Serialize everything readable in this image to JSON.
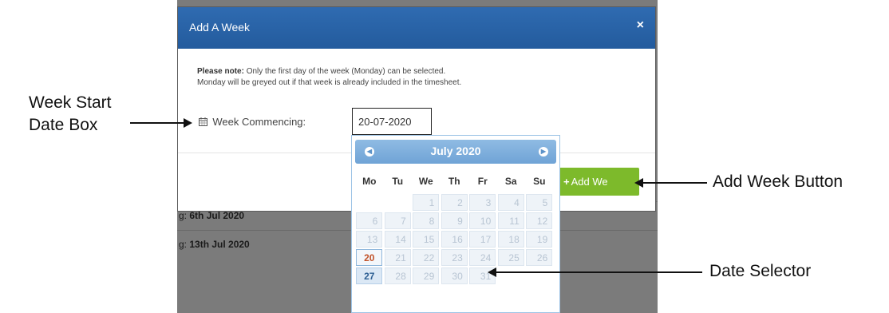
{
  "background_page": {
    "row1_prefix": "g:",
    "row1_value": "6th Jul 2020",
    "row2_prefix": "g:",
    "row2_value": "13th Jul 2020"
  },
  "modal": {
    "title": "Add A Week",
    "close_glyph": "×",
    "note_bold": "Please note:",
    "note_line1": " Only the first day of the week (Monday) can be selected.",
    "note_line2": "Monday will be greyed out if that week is already included in the timesheet.",
    "week_commencing_label": "Week Commencing:",
    "date_value": "20-07-2020",
    "add_week_label": "Add Week",
    "add_week_visible_label": "Add We"
  },
  "datepicker": {
    "month_label": "July  2020",
    "prev_glyph": "◀",
    "next_glyph": "▶",
    "weekdays": [
      "Mo",
      "Tu",
      "We",
      "Th",
      "Fr",
      "Sa",
      "Su"
    ],
    "weeks": [
      [
        "",
        "",
        "1",
        "2",
        "3",
        "4",
        "5"
      ],
      [
        "6",
        "7",
        "8",
        "9",
        "10",
        "11",
        "12"
      ],
      [
        "13",
        "14",
        "15",
        "16",
        "17",
        "18",
        "19"
      ],
      [
        "20",
        "21",
        "22",
        "23",
        "24",
        "25",
        "26"
      ],
      [
        "27",
        "28",
        "29",
        "30",
        "31",
        "",
        ""
      ]
    ],
    "selected_day": "20",
    "selectable_day": "27"
  },
  "annotations": {
    "week_start_line1": "Week Start",
    "week_start_line2": "Date Box",
    "add_week_button": "Add Week Button",
    "date_selector": "Date Selector"
  },
  "colors": {
    "header_blue": "#2f6bb1",
    "add_button_green": "#7dba2b",
    "selected_orange": "#c1532a"
  }
}
